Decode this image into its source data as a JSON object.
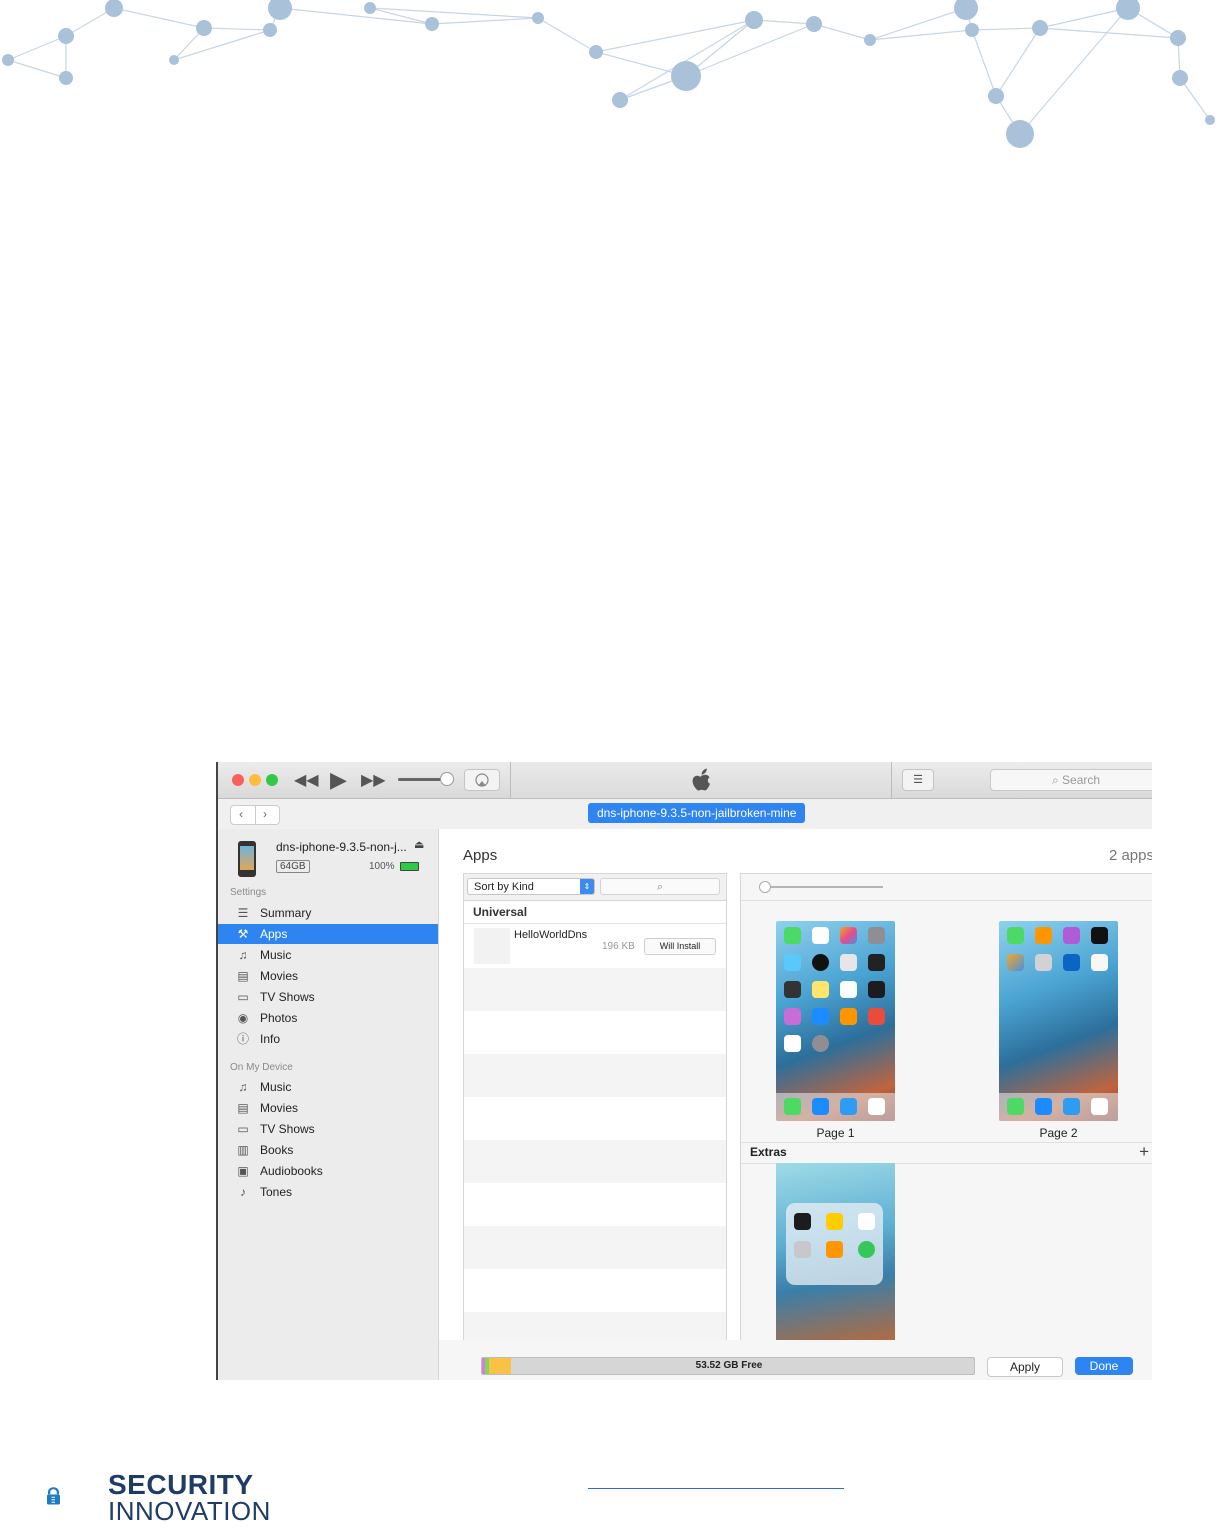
{
  "window": {
    "search_placeholder": "Search",
    "device_pill": "dns-iphone-9.3.5-non-jailbroken-mine"
  },
  "device": {
    "name": "dns-iphone-9.3.5-non-j...",
    "capacity": "64GB",
    "battery_percent": "100%",
    "battery_level": 1.0
  },
  "sidebar": {
    "settings_heading": "Settings",
    "settings_items": [
      {
        "label": "Summary",
        "icon": "summary-icon"
      },
      {
        "label": "Apps",
        "icon": "apps-icon",
        "selected": true
      },
      {
        "label": "Music",
        "icon": "music-icon"
      },
      {
        "label": "Movies",
        "icon": "movies-icon"
      },
      {
        "label": "TV Shows",
        "icon": "tv-shows-icon"
      },
      {
        "label": "Photos",
        "icon": "camera-icon"
      },
      {
        "label": "Info",
        "icon": "info-icon"
      }
    ],
    "device_heading": "On My Device",
    "device_items": [
      {
        "label": "Music",
        "icon": "music-icon"
      },
      {
        "label": "Movies",
        "icon": "movies-icon"
      },
      {
        "label": "TV Shows",
        "icon": "tv-shows-icon"
      },
      {
        "label": "Books",
        "icon": "books-icon"
      },
      {
        "label": "Audiobooks",
        "icon": "audiobooks-icon"
      },
      {
        "label": "Tones",
        "icon": "bell-icon"
      }
    ]
  },
  "apps": {
    "title": "Apps",
    "count": "2 apps",
    "sort_label": "Sort by Kind",
    "group_label": "Universal",
    "items": [
      {
        "name": "HelloWorldDns",
        "size": "196 KB",
        "action": "Will Install"
      }
    ]
  },
  "home_screens": {
    "pages": [
      "Page 1",
      "Page 2"
    ],
    "extras_label": "Extras"
  },
  "footer": {
    "storage_free": "53.52 GB Free",
    "apply_label": "Apply",
    "done_label": "Done"
  },
  "branding": {
    "line1": "SECURITY",
    "line2": "INNOVATION"
  },
  "colors": {
    "accent": "#2e84f0",
    "brand": "#1f3c66",
    "network": "#aac3d9"
  }
}
